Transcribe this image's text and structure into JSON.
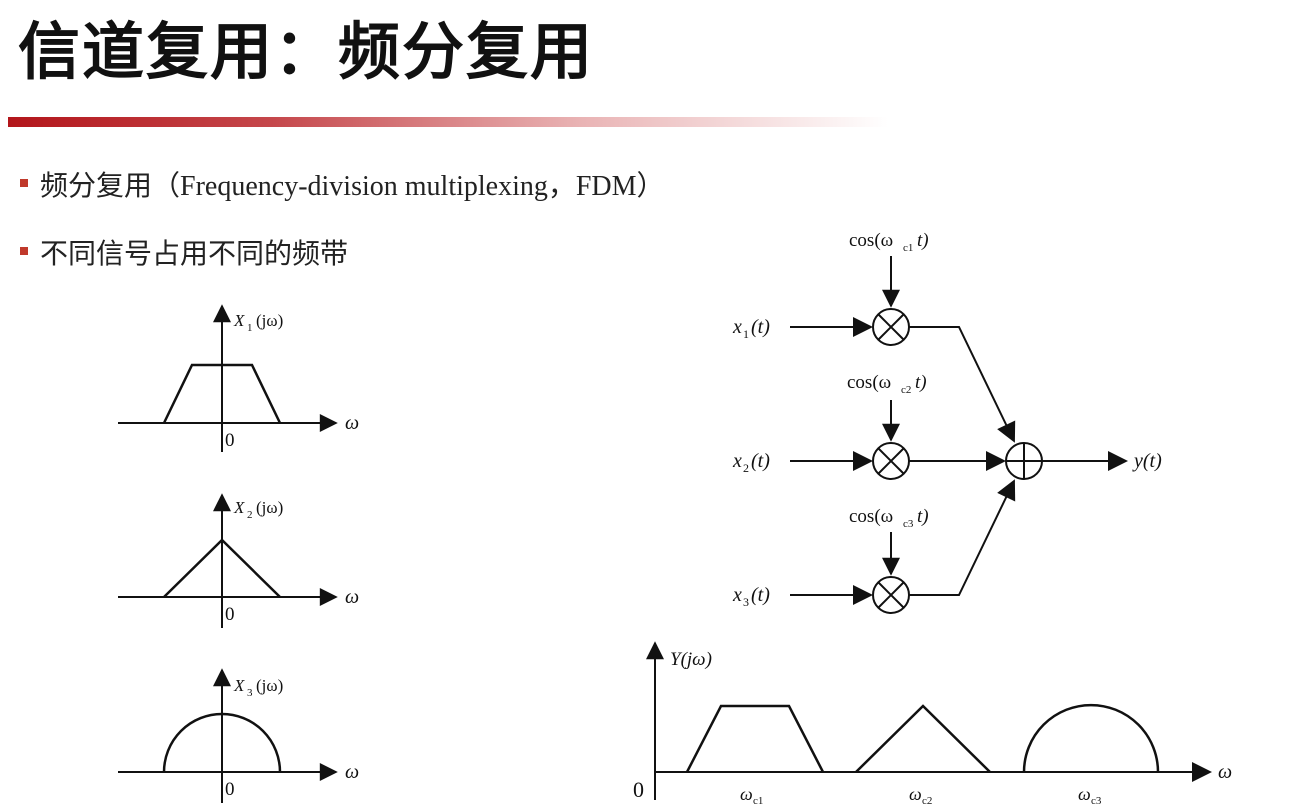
{
  "slide": {
    "title": "信道复用：频分复用",
    "accent_color": "#b3161b"
  },
  "bullets": [
    {
      "zh": "频分复用（",
      "en": "Frequency-division multiplexing，FDM）"
    },
    {
      "zh": "不同信号占用不同的频带",
      "en": ""
    }
  ],
  "spectra": {
    "axis_label": "ω",
    "origin": "0",
    "items": [
      {
        "label_base": "X",
        "label_sub": "1",
        "label_tail": "(jω)",
        "shape": "trapezoid"
      },
      {
        "label_base": "X",
        "label_sub": "2",
        "label_tail": "(jω)",
        "shape": "triangle"
      },
      {
        "label_base": "X",
        "label_sub": "3",
        "label_tail": "(jω)",
        "shape": "semicircle"
      }
    ]
  },
  "block_diagram": {
    "inputs": [
      {
        "base": "x",
        "sub": "1",
        "tail": "(t)"
      },
      {
        "base": "x",
        "sub": "2",
        "tail": "(t)"
      },
      {
        "base": "x",
        "sub": "3",
        "tail": "(t)"
      }
    ],
    "carriers": [
      {
        "pre": "cos(ω",
        "sub": "c1",
        "post": "t)"
      },
      {
        "pre": "cos(ω",
        "sub": "c2",
        "post": "t)"
      },
      {
        "pre": "cos(ω",
        "sub": "c3",
        "post": "t)"
      }
    ],
    "output": "y(t)"
  },
  "combined_spectrum": {
    "y_label": "Y(jω)",
    "axis_label": "ω",
    "origin": "0",
    "centers": [
      {
        "base": "ω",
        "sub": "c1"
      },
      {
        "base": "ω",
        "sub": "c2"
      },
      {
        "base": "ω",
        "sub": "c3"
      }
    ]
  }
}
